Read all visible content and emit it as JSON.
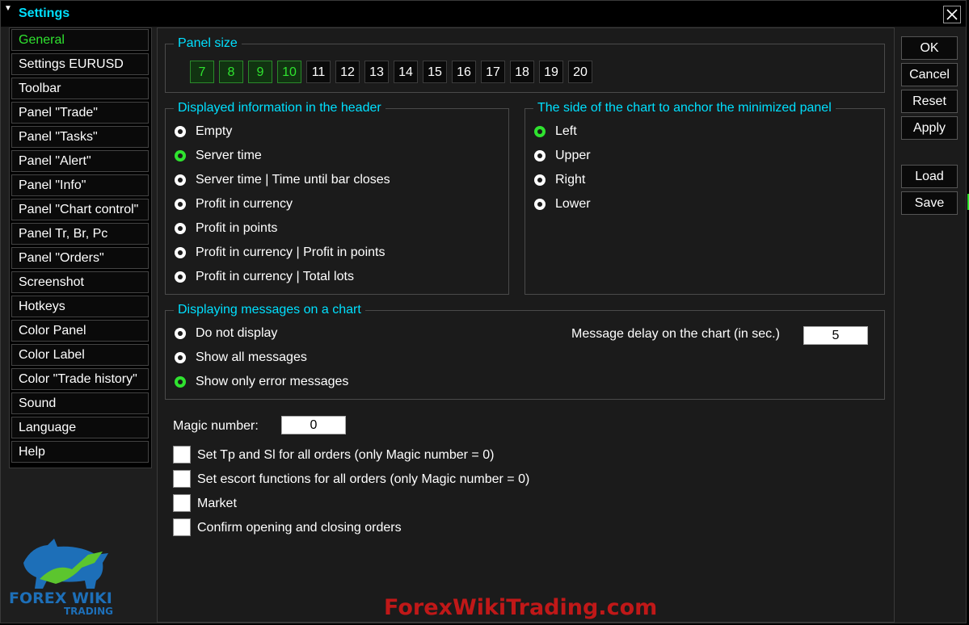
{
  "window": {
    "title": "Settings"
  },
  "sidebar": {
    "items": [
      {
        "label": "General",
        "active": true
      },
      {
        "label": "Settings EURUSD"
      },
      {
        "label": "Toolbar"
      },
      {
        "label": "Panel \"Trade\""
      },
      {
        "label": "Panel \"Tasks\""
      },
      {
        "label": "Panel \"Alert\""
      },
      {
        "label": "Panel \"Info\""
      },
      {
        "label": "Panel \"Chart control\""
      },
      {
        "label": "Panel Tr, Br, Pc"
      },
      {
        "label": "Panel \"Orders\""
      },
      {
        "label": "Screenshot"
      },
      {
        "label": "Hotkeys"
      },
      {
        "label": "Color Panel"
      },
      {
        "label": "Color Label"
      },
      {
        "label": "Color \"Trade history\""
      },
      {
        "label": "Sound"
      },
      {
        "label": "Language"
      },
      {
        "label": "Help"
      }
    ]
  },
  "panel_size": {
    "title": "Panel size",
    "options": [
      "7",
      "8",
      "9",
      "10",
      "11",
      "12",
      "13",
      "14",
      "15",
      "16",
      "17",
      "18",
      "19",
      "20"
    ],
    "highlighted": [
      "7",
      "8",
      "9",
      "10"
    ]
  },
  "header_info": {
    "title": "Displayed information in the header",
    "options": [
      {
        "label": "Empty"
      },
      {
        "label": "Server time",
        "selected": true
      },
      {
        "label": "Server time | Time until bar closes"
      },
      {
        "label": "Profit in currency"
      },
      {
        "label": "Profit in points"
      },
      {
        "label": "Profit in currency | Profit in points"
      },
      {
        "label": "Profit in currency | Total lots"
      }
    ]
  },
  "anchor_side": {
    "title": "The side of the chart to anchor the minimized panel",
    "options": [
      {
        "label": "Left",
        "selected": true
      },
      {
        "label": "Upper"
      },
      {
        "label": "Right"
      },
      {
        "label": "Lower"
      }
    ]
  },
  "messages": {
    "title": "Displaying messages on a chart",
    "options": [
      {
        "label": "Do not display"
      },
      {
        "label": "Show all messages"
      },
      {
        "label": "Show only error messages",
        "selected": true
      }
    ],
    "delay_label": "Message delay on the chart (in sec.)",
    "delay_value": "5"
  },
  "magic": {
    "label": "Magic number:",
    "value": "0"
  },
  "checkboxes": [
    {
      "label": "Set Tp and Sl for all orders (only Magic number = 0)",
      "checked": false
    },
    {
      "label": "Set escort functions for all orders (only Magic number = 0)",
      "checked": false
    },
    {
      "label": "Market",
      "checked": false
    },
    {
      "label": "Confirm opening and closing orders",
      "checked": false
    }
  ],
  "buttons": {
    "ok": "OK",
    "cancel": "Cancel",
    "reset": "Reset",
    "apply": "Apply",
    "load": "Load",
    "save": "Save"
  },
  "logo": {
    "line1": "FOREX WIKI",
    "line2": "TRADING"
  },
  "watermark": "ForexWikiTrading.com",
  "colors": {
    "accent": "#00e0ff",
    "selected": "#2fe32f",
    "watermark": "#c01818"
  }
}
